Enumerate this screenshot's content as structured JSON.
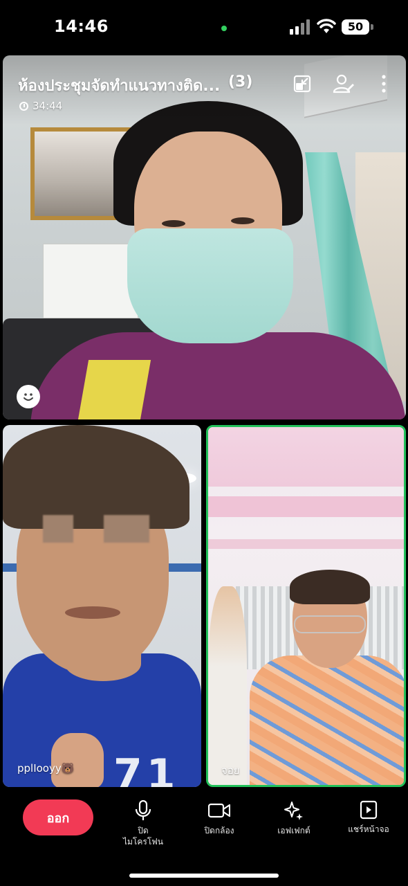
{
  "status_bar": {
    "time": "14:46",
    "battery": "50"
  },
  "meeting": {
    "title": "ห้องประชุมจัดทำแนวทางติด...",
    "participant_count": "(3)",
    "duration": "34:44"
  },
  "participants": [
    {
      "name": ""
    },
    {
      "name": "pplIooyy🐻"
    },
    {
      "name": "จอย"
    }
  ],
  "toolbar": {
    "leave_label": "ออก",
    "mic_label": "ปิด\nไมโครโฟน",
    "camera_label": "ปิดกล้อง",
    "effects_label": "เอฟเฟกต์",
    "share_label": "แชร์หน้าจอ"
  },
  "colors": {
    "leave_button": "#f23a55",
    "active_speaker_border": "#22c15a",
    "camera_indicator": "#33d060"
  },
  "icons": [
    "signal-icon",
    "wifi-icon",
    "battery-icon",
    "minimize-icon",
    "add-participant-icon",
    "more-icon",
    "clock-icon",
    "emoji-icon",
    "microphone-icon",
    "camera-icon",
    "effects-icon",
    "share-screen-icon"
  ]
}
